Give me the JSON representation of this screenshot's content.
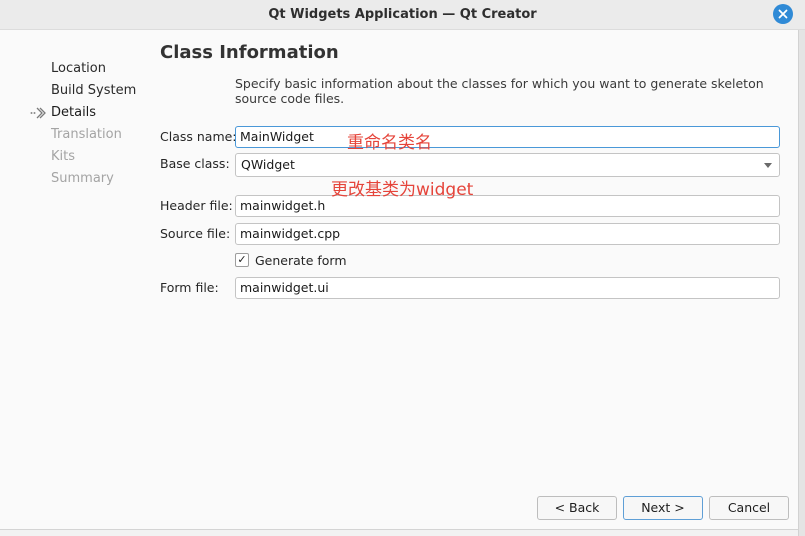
{
  "window": {
    "title": "Qt Widgets Application — Qt Creator"
  },
  "sidebar": {
    "steps": [
      {
        "label": "Location",
        "state": "done"
      },
      {
        "label": "Build System",
        "state": "done"
      },
      {
        "label": "Details",
        "state": "current"
      },
      {
        "label": "Translation",
        "state": "pending"
      },
      {
        "label": "Kits",
        "state": "pending"
      },
      {
        "label": "Summary",
        "state": "pending"
      }
    ]
  },
  "page": {
    "title": "Class Information",
    "description": "Specify basic information about the classes for which you want to generate skeleton source code files."
  },
  "form": {
    "class_name": {
      "label": "Class name:",
      "value": "MainWidget"
    },
    "base_class": {
      "label": "Base class:",
      "value": "QWidget"
    },
    "header_file": {
      "label": "Header file:",
      "value": "mainwidget.h"
    },
    "source_file": {
      "label": "Source file:",
      "value": "mainwidget.cpp"
    },
    "generate_form": {
      "label": "Generate form",
      "checked": true,
      "mark": "✓"
    },
    "form_file": {
      "label": "Form file:",
      "value": "mainwidget.ui"
    }
  },
  "annotations": {
    "rename_class": "重命名类名",
    "change_base": "更改基类为widget"
  },
  "buttons": {
    "back": "< Back",
    "next": "Next >",
    "cancel": "Cancel"
  },
  "icons": {
    "close": "close-icon",
    "step_arrow": "chevron-right-icon",
    "combo_caret": "chevron-down-icon"
  },
  "colors": {
    "accent": "#2f8ad6",
    "annotation": "#e5443a",
    "focus_border": "#4a98d8"
  }
}
